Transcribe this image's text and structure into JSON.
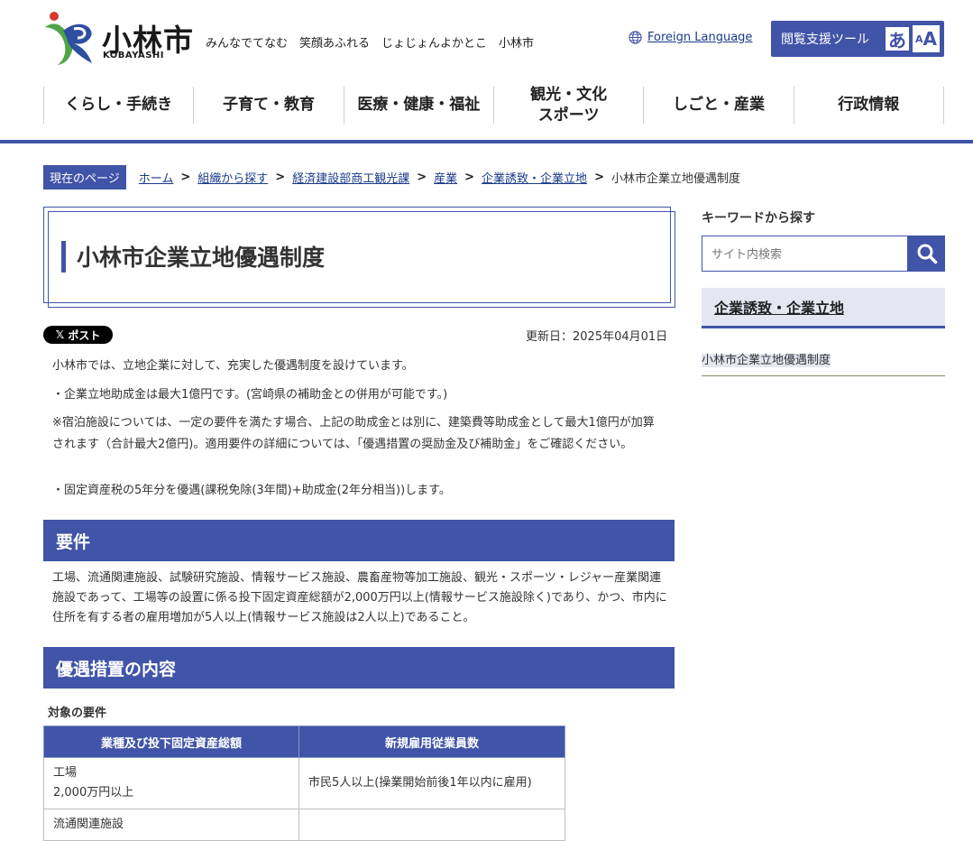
{
  "header": {
    "logo_name": "小林市",
    "logo_roman": "KOBAYASHI",
    "slogan": "みんなでてなむ　笑顔あふれる　じょじょんよかとこ　小林市",
    "foreign_language": "Foreign Language",
    "support_tools": "閲覧支援ツール",
    "support_hiragana": "あ",
    "support_letter": "A"
  },
  "nav": {
    "items": [
      "くらし・手続き",
      "子育て・教育",
      "医療・健康・福祉",
      "観光・文化\nスポーツ",
      "しごと・産業",
      "行政情報"
    ]
  },
  "breadcrumb": {
    "here": "現在のページ",
    "links": [
      "ホーム",
      "組織から探す",
      "経済建設部商工観光課",
      "産業",
      "企業誘致・企業立地"
    ],
    "current": "小林市企業立地優遇制度",
    "separator": ">"
  },
  "main": {
    "title": "小林市企業立地優遇制度",
    "xpost": "ポスト",
    "updated": "更新日：2025年04月01日",
    "intro": [
      "小林市では、立地企業に対して、充実した優遇制度を設けています。",
      "・企業立地助成金は最大1億円です。(宮崎県の補助金との併用が可能です。)",
      "※宿泊施設については、一定の要件を満たす場合、上記の助成金とは別に、建築費等助成金として最大1億円が加算されます（合計最大2億円)。適用要件の詳細については、「優遇措置の奨励金及び補助金」をご確認ください。",
      "・固定資産税の5年分を優遇(課税免除(3年間)+助成金(2年分相当))します。"
    ],
    "section1_heading": "要件",
    "section1_text": "工場、流通関連施設、試験研究施設、情報サービス施設、農畜産物等加工施設、観光・スポーツ・レジャー産業関連施設であって、工場等の設置に係る投下固定資産総額が2,000万円以上(情報サービス施設除く)であり、かつ、市内に住所を有する者の雇用増加が5人以上(情報サービス施設は2人以上)であること。",
    "section2_heading": "優遇措置の内容",
    "table_caption": "対象の要件",
    "table": {
      "headers": [
        "業種及び投下固定資産総額",
        "新規雇用従業員数"
      ],
      "rows": [
        [
          "工場",
          "2,000万円以上",
          "市民5人以上(操業開始前後1年以内に雇用)"
        ],
        [
          "流通関連施設",
          "",
          ""
        ]
      ]
    }
  },
  "sidebar": {
    "keyword_title": "キーワードから探す",
    "search_placeholder": "サイト内検索",
    "category": "企業誘致・企業立地",
    "item": "小林市企業立地優遇制度"
  },
  "colors": {
    "accent": "#4054a8",
    "accent_light": "#e4e7f2",
    "logo_green": "#4fa545",
    "logo_blue": "#2e4fa0",
    "logo_red": "#d43a2a"
  }
}
